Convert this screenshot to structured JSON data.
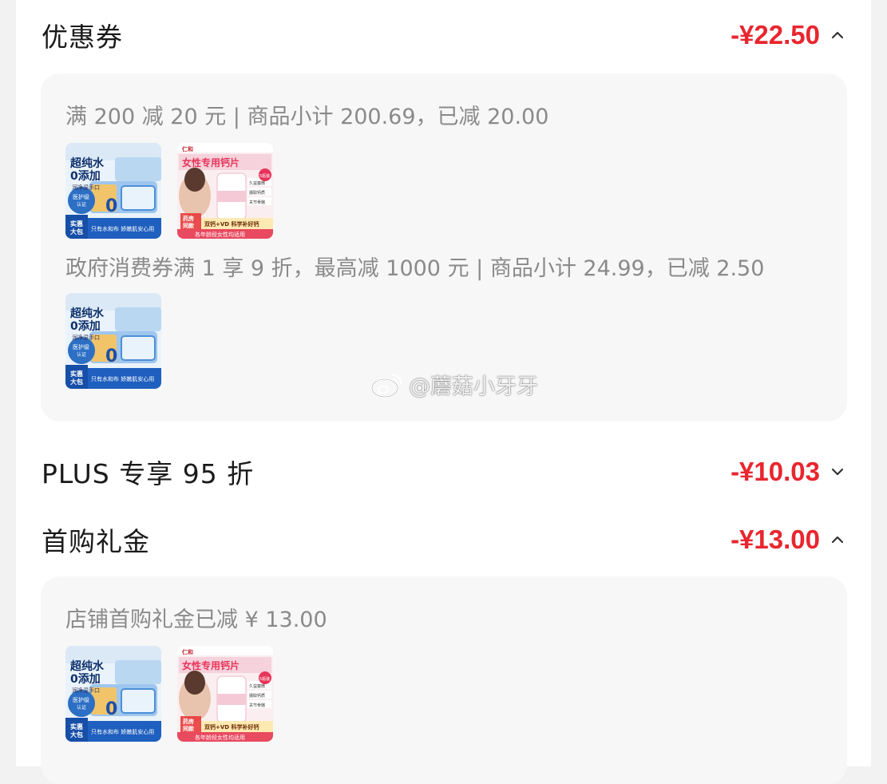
{
  "colors": {
    "accent": "#e8262f",
    "muted_text": "#8a8a8a",
    "panel_bg": "#f7f7f7"
  },
  "coupon": {
    "title": "优惠券",
    "amount": "-¥22.50",
    "expanded": true,
    "rules": [
      {
        "text": "满 200 减 20 元 | 商品小计 200.69，已减 20.00",
        "products": [
          "wipes",
          "calcium"
        ]
      },
      {
        "text": "政府消费券满 1 享 9 折，最高减 1000 元 | 商品小计 24.99，已减 2.50",
        "products": [
          "wipes"
        ]
      }
    ]
  },
  "plus": {
    "title": "PLUS 专享 95 折",
    "amount": "-¥10.03",
    "expanded": false
  },
  "first_gift": {
    "title": "首购礼金",
    "amount": "-¥13.00",
    "expanded": true,
    "rules": [
      {
        "text": "店铺首购礼金已减 ¥ 13.00",
        "products": [
          "wipes",
          "calcium"
        ]
      }
    ]
  },
  "products": {
    "wipes": {
      "headline_1": "超纯水",
      "headline_2": "0添加",
      "sub": "润净湿手口",
      "badge": "医护级",
      "badge_sub": "认证",
      "bottom_left_1": "实惠",
      "bottom_left_2": "大包",
      "bottom_right": "只有水和布 娇嫩肌安心用",
      "big_digit": "0"
    },
    "calcium": {
      "brand": "仁和",
      "title": "女性专用钙片",
      "tag": "5瓶装",
      "tag_small": "限量",
      "side_1": "久益塞微",
      "side_2": "摄取钙质",
      "side_3": "关节骨骼",
      "left_tag_1": "药房",
      "left_tag_2": "同款",
      "price_tag": "每瓶500片",
      "bottom_1": "双钙+VD 科学补好钙",
      "bottom_2": "各年龄段女性均适用"
    }
  },
  "watermark": {
    "text": "@蘑菇小牙牙",
    "icon": "weibo-icon"
  }
}
